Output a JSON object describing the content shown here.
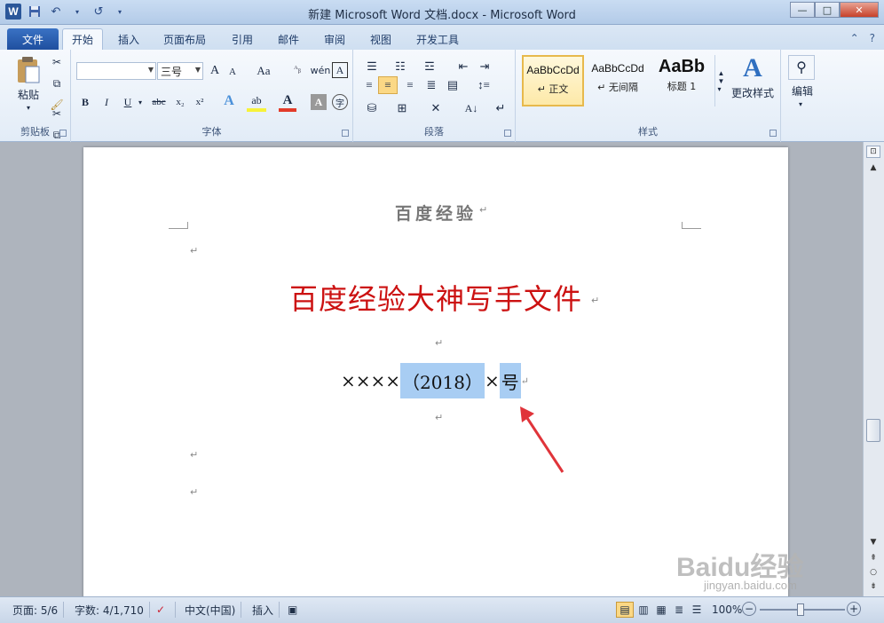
{
  "titlebar": {
    "title": "新建 Microsoft Word 文档.docx - Microsoft Word",
    "app_icon_letter": "W",
    "minimize": "—",
    "maximize": "□",
    "close": "✕"
  },
  "tabs": {
    "file": "文件",
    "items": [
      "开始",
      "插入",
      "页面布局",
      "引用",
      "邮件",
      "审阅",
      "视图",
      "开发工具"
    ],
    "active": "开始",
    "help_icon": "?"
  },
  "ribbon": {
    "clipboard": {
      "paste_label": "粘贴",
      "group_label": "剪贴板"
    },
    "font": {
      "font_name": "",
      "font_size": "三号",
      "group_label": "字体",
      "bold": "B",
      "italic": "I",
      "underline": "U",
      "strike": "abc",
      "subscript": "x₂",
      "superscript": "x²",
      "case": "Aa",
      "grow": "A",
      "shrink": "A",
      "pinyin": "wén",
      "phonetic": "变",
      "border_char": "A",
      "enclose": "字"
    },
    "paragraph": {
      "group_label": "段落"
    },
    "styles": {
      "group_label": "样式",
      "items": [
        {
          "sample": "AaBbCcDd",
          "name": "↵ 正文",
          "selected": true
        },
        {
          "sample": "AaBbCcDd",
          "name": "↵ 无间隔",
          "selected": false
        },
        {
          "sample": "AaBb",
          "name": "标题 1",
          "selected": false
        }
      ],
      "change_styles": "更改样式"
    },
    "editing": {
      "label": "编辑"
    }
  },
  "document": {
    "header_text": "百度经验",
    "red_title": "百度经验大神写手文件",
    "doc_number": {
      "prefix": "××××",
      "year_part": "（2018）",
      "middle": "×",
      "suffix": "号"
    },
    "paragraph_mark": "↵"
  },
  "statusbar": {
    "page": "页面: 5/6",
    "words": "字数: 4/1,710",
    "language": "中文(中国)",
    "mode": "插入",
    "zoom": "100%",
    "zoom_minus": "−",
    "zoom_plus": "+"
  },
  "watermark": {
    "brand": "Baidu经验",
    "url": "jingyan.baidu.com"
  },
  "colors": {
    "title_red": "#cc1111",
    "selection": "#a8cdf3",
    "arrow": "#e0343a",
    "file_tab": "#2b5ea8"
  }
}
